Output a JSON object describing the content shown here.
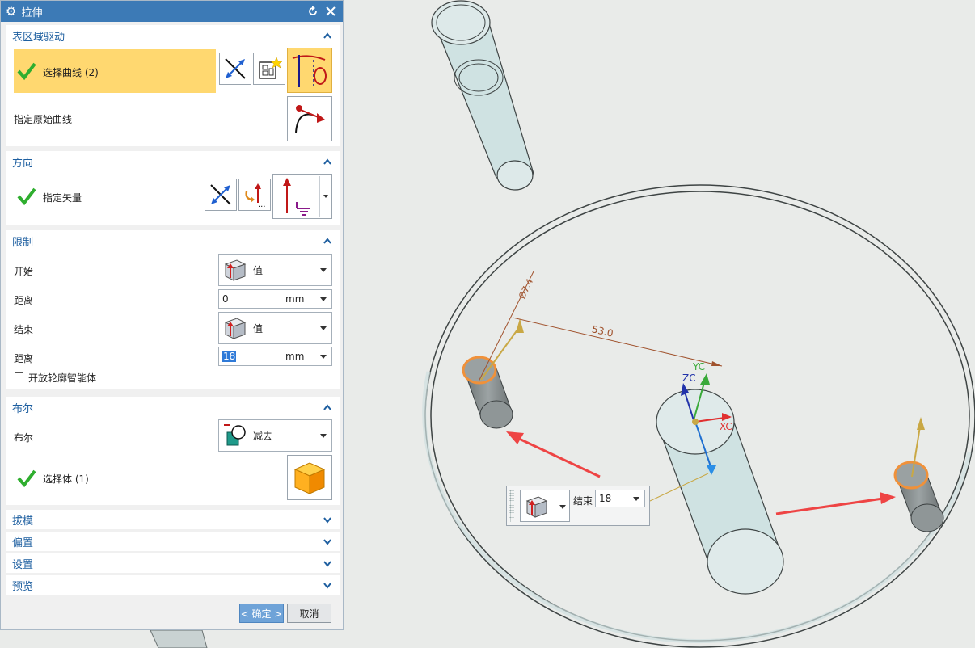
{
  "dialog": {
    "title": "拉伸"
  },
  "section_curve": {
    "header": "表区域驱动",
    "select_curve_label": "选择曲线 (2)",
    "origin_curve_label": "指定原始曲线"
  },
  "section_direction": {
    "header": "方向",
    "vector_label": "指定矢量"
  },
  "section_limits": {
    "header": "限制",
    "start_label": "开始",
    "start_value": "值",
    "start_distance_label": "距离",
    "start_distance_value": "0",
    "start_unit": "mm",
    "end_label": "结束",
    "end_value": "值",
    "end_distance_label": "距离",
    "end_distance_value": "18",
    "end_unit": "mm",
    "open_profile_label": "开放轮廓智能体"
  },
  "section_boolean": {
    "header": "布尔",
    "boolean_label": "布尔",
    "boolean_value": "减去",
    "select_body_label": "选择体 (1)"
  },
  "collapsed_sections": {
    "draft": "拔模",
    "offset": "偏置",
    "settings": "设置",
    "preview": "预览"
  },
  "buttons": {
    "ok": "< 确定 >",
    "cancel": "取消"
  },
  "viewport": {
    "dim_diameter": "Ø7.4",
    "dim_distance": "53.0",
    "axis_x": "XC",
    "axis_y": "YC",
    "axis_z": "ZC",
    "float_label": "结束",
    "float_value": "18"
  },
  "colors": {
    "titlebar": "#3c7ab6",
    "header_text": "#1e5fa0",
    "selection_highlight": "#ffd870",
    "body_fill": "#cfe0e0",
    "callout_arrow": "#ee4444",
    "dimension": "#a0522d"
  }
}
